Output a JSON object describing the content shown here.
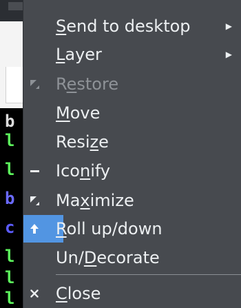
{
  "terminal": {
    "lines": [
      {
        "text": "b",
        "color": "#dcdcdc"
      },
      {
        "text": "l",
        "color": "#5cf25c"
      },
      {
        "text": "l",
        "color": "#5cf25c"
      },
      {
        "text": "b",
        "color": "#6a6aff"
      },
      {
        "text": "c",
        "color": "#5c5cff"
      },
      {
        "text": "l",
        "color": "#5cf25c"
      },
      {
        "text": "l",
        "color": "#5cf25c"
      },
      {
        "text": "l",
        "color": "#5cf25c"
      }
    ]
  },
  "menu": {
    "items": [
      {
        "id": "send-to-desktop",
        "pre": "",
        "mnemonic": "S",
        "post": "end to desktop",
        "icon": "",
        "submenu": true,
        "disabled": false,
        "highlighted": false
      },
      {
        "id": "layer",
        "pre": "",
        "mnemonic": "L",
        "post": "ayer",
        "icon": "",
        "submenu": true,
        "disabled": false,
        "highlighted": false
      },
      {
        "id": "restore",
        "pre": "R",
        "mnemonic": "e",
        "post": "store",
        "icon": "restore-icon",
        "submenu": false,
        "disabled": true,
        "highlighted": false
      },
      {
        "id": "move",
        "pre": "",
        "mnemonic": "M",
        "post": "ove",
        "icon": "",
        "submenu": false,
        "disabled": false,
        "highlighted": false
      },
      {
        "id": "resize",
        "pre": "Resi",
        "mnemonic": "z",
        "post": "e",
        "icon": "",
        "submenu": false,
        "disabled": false,
        "highlighted": false
      },
      {
        "id": "iconify",
        "pre": "Ico",
        "mnemonic": "n",
        "post": "ify",
        "icon": "iconify-icon",
        "submenu": false,
        "disabled": false,
        "highlighted": false
      },
      {
        "id": "maximize",
        "pre": "Ma",
        "mnemonic": "x",
        "post": "imize",
        "icon": "maximize-icon",
        "submenu": false,
        "disabled": false,
        "highlighted": false
      },
      {
        "id": "roll-up-down",
        "pre": "",
        "mnemonic": "R",
        "post": "oll up/down",
        "icon": "arrow-up-icon",
        "submenu": false,
        "disabled": false,
        "highlighted": true
      },
      {
        "id": "un-decorate",
        "pre": "Un/",
        "mnemonic": "D",
        "post": "ecorate",
        "icon": "",
        "submenu": false,
        "disabled": false,
        "highlighted": false
      },
      {
        "id": "close",
        "pre": "",
        "mnemonic": "C",
        "post": "lose",
        "icon": "close-icon",
        "submenu": false,
        "disabled": false,
        "highlighted": false
      }
    ],
    "submenu_arrow": "▶",
    "colors": {
      "background": "#474a4f",
      "text": "#eceff1",
      "disabled_text": "#8e9297",
      "highlight": "#5295e2"
    }
  }
}
